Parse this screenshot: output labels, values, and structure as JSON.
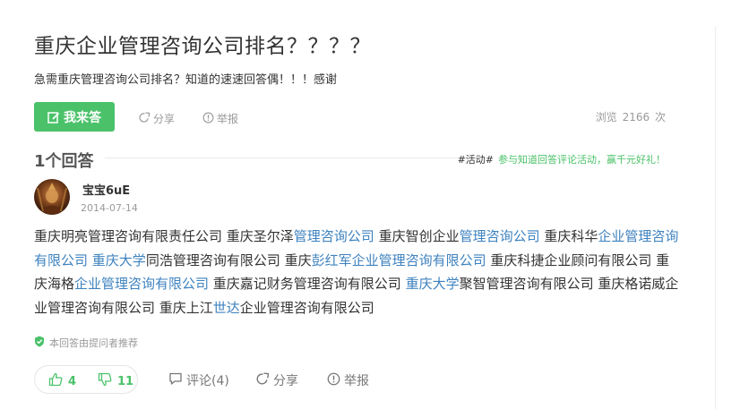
{
  "question": {
    "title": "重庆企业管理咨询公司排名？？？？",
    "description": "急需重庆管理咨询公司排名？知道的速速回答偶！！！感谢"
  },
  "actions": {
    "answer_label": "我来答",
    "share_label": "分享",
    "report_label": "举报",
    "views_label": "浏览",
    "views_count": "2166",
    "views_unit": "次"
  },
  "answers_header": {
    "count_label": "1个回答",
    "activity_tag": "#活动#",
    "activity_text": "参与知道回答评论活动，赢千元好礼！"
  },
  "answer": {
    "username": "宝宝6uE",
    "date": "2014-07-14",
    "segments": [
      {
        "t": "重庆明亮管理咨询有限责任公司 重庆圣尔泽",
        "link": false
      },
      {
        "t": "管理咨询公司",
        "link": true
      },
      {
        "t": " 重庆智创企业",
        "link": false
      },
      {
        "t": "管理咨询公司",
        "link": true
      },
      {
        "t": " 重庆科华",
        "link": false
      },
      {
        "t": "企业管理咨询有限公司",
        "link": true
      },
      {
        "t": " ",
        "link": false
      },
      {
        "t": "重庆大学",
        "link": true
      },
      {
        "t": "同浩管理咨询有限公司 重庆",
        "link": false
      },
      {
        "t": "彭红军企业管理咨询有限公司",
        "link": true
      },
      {
        "t": " 重庆科捷企业顾问有限公司 重庆海格",
        "link": false
      },
      {
        "t": "企业管理咨询有限公司",
        "link": true
      },
      {
        "t": " 重庆嘉记财务管理咨询有限公司 ",
        "link": false
      },
      {
        "t": "重庆大学",
        "link": true
      },
      {
        "t": "聚智管理咨询有限公司 重庆格诺威企业管理咨询有限公司 重庆上江",
        "link": false
      },
      {
        "t": "世达",
        "link": true
      },
      {
        "t": "企业管理咨询有限公司",
        "link": false
      }
    ],
    "recommend_label": "本回答由提问者推荐",
    "likes": "4",
    "dislikes": "11",
    "comment_label": "评论(4)",
    "share_label": "分享",
    "report_label": "举报"
  },
  "colors": {
    "accent": "#4bc26a",
    "link": "#3e82bf"
  }
}
